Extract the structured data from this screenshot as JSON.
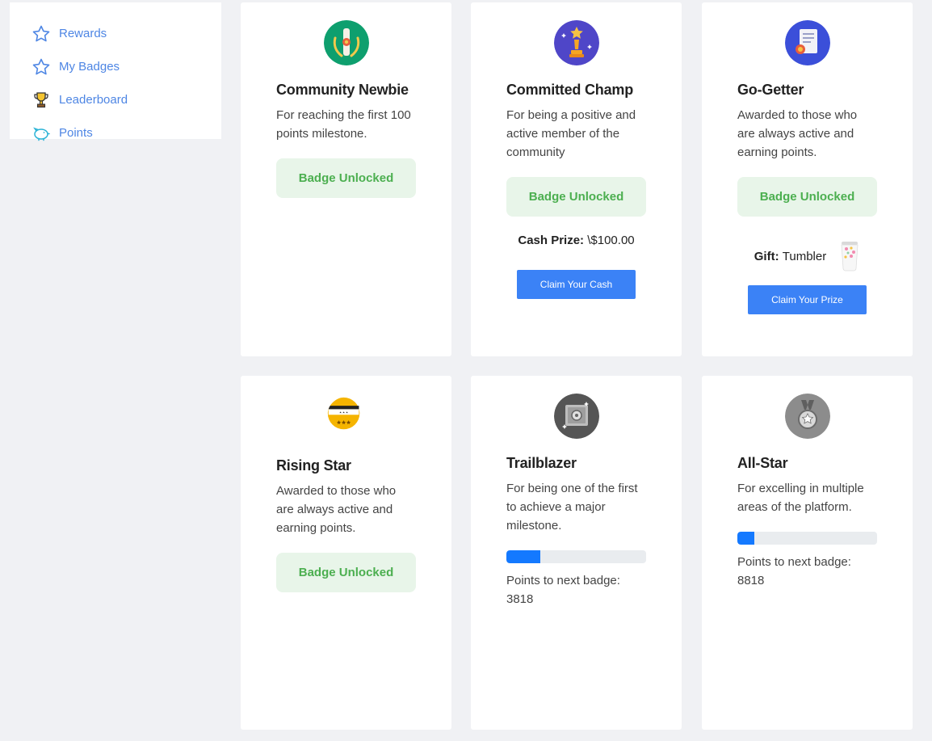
{
  "sidebar": {
    "items": [
      {
        "label": "Rewards",
        "icon": "star-outline-icon"
      },
      {
        "label": "My Badges",
        "icon": "star-outline-icon"
      },
      {
        "label": "Leaderboard",
        "icon": "trophy-icon"
      },
      {
        "label": "Points",
        "icon": "piggy-bank-icon"
      }
    ]
  },
  "badges": [
    {
      "title": "Community Newbie",
      "desc": "For reaching the first 100 points milestone.",
      "status": "Badge Unlocked",
      "icon": "scroll-laurel-icon",
      "color": "#0e9f6e"
    },
    {
      "title": "Committed Champ",
      "desc": "For being a positive and active member of the community",
      "status": "Badge Unlocked",
      "icon": "trophy-star-icon",
      "color": "#4f46c8",
      "prize_label": "Cash Prize:",
      "prize_value": "\\$100.00",
      "button": "Claim Your Cash"
    },
    {
      "title": "Go-Getter",
      "desc": "Awarded to those who are always active and earning points.",
      "status": "Badge Unlocked",
      "icon": "certificate-icon",
      "color": "#3b4fd9",
      "prize_label": "Gift:",
      "prize_value": "Tumbler",
      "prize_image": "tumbler-image",
      "button": "Claim Your Prize"
    },
    {
      "title": "Rising Star",
      "desc": "Awarded to those who are always active and earning points.",
      "status": "Badge Unlocked",
      "icon": "ticket-stars-icon",
      "color": "#f5b400"
    },
    {
      "title": "Trailblazer",
      "desc": "For being one of the first to achieve a major milestone.",
      "icon": "safe-icon",
      "color": "#555555",
      "progress": 0.24,
      "points_label": "Points to next badge:",
      "points": "3818"
    },
    {
      "title": "All-Star",
      "desc": "For excelling in multiple areas of the platform.",
      "icon": "medal-icon",
      "color": "#8c8c8c",
      "progress": 0.12,
      "points_label": "Points to next badge:",
      "points": "8818"
    }
  ]
}
